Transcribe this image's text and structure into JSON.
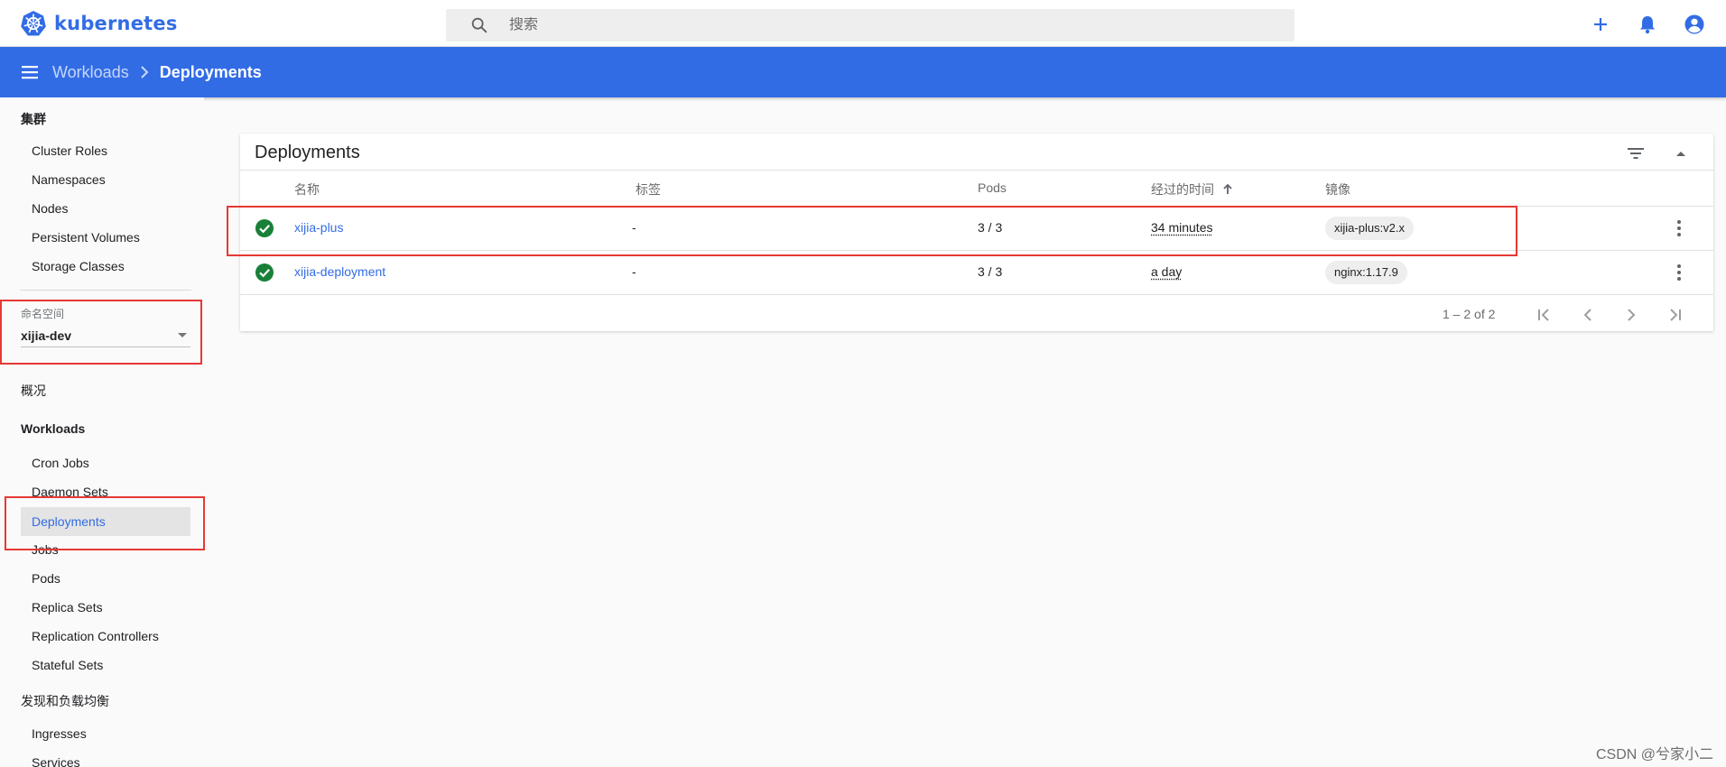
{
  "app": {
    "brand": "kubernetes",
    "search_placeholder": "搜索",
    "accent": "#326ce5"
  },
  "topbar_icons": [
    "plus-icon",
    "bell-icon",
    "account-icon"
  ],
  "breadcrumb": {
    "parent": "Workloads",
    "current": "Deployments"
  },
  "sidebar": {
    "cluster_section": "集群",
    "cluster_items": [
      "Cluster Roles",
      "Namespaces",
      "Nodes",
      "Persistent Volumes",
      "Storage Classes"
    ],
    "namespace_label": "命名空间",
    "namespace_value": "xijia-dev",
    "overview": "概况",
    "workloads_section": "Workloads",
    "workloads_items": [
      "Cron Jobs",
      "Daemon Sets",
      "Deployments",
      "Jobs",
      "Pods",
      "Replica Sets",
      "Replication Controllers",
      "Stateful Sets"
    ],
    "discovery_section": "发现和负载均衡",
    "discovery_items": [
      "Ingresses",
      "Services"
    ]
  },
  "card": {
    "title": "Deployments",
    "columns": {
      "name": "名称",
      "labels": "标签",
      "pods": "Pods",
      "age": "经过的时间",
      "images": "镜像"
    },
    "rows": [
      {
        "name": "xijia-plus",
        "labels": "-",
        "pods": "3 / 3",
        "age": "34 minutes",
        "image": "xijia-plus:v2.x",
        "status": "running"
      },
      {
        "name": "xijia-deployment",
        "labels": "-",
        "pods": "3 / 3",
        "age": "a day",
        "image": "nginx:1.17.9",
        "status": "running"
      }
    ],
    "pagination": "1 – 2 of 2"
  },
  "colors": {
    "header": "#326ce5",
    "status_ok": "#188038",
    "annotation": "#e53935"
  },
  "watermark": "CSDN @兮家小二"
}
